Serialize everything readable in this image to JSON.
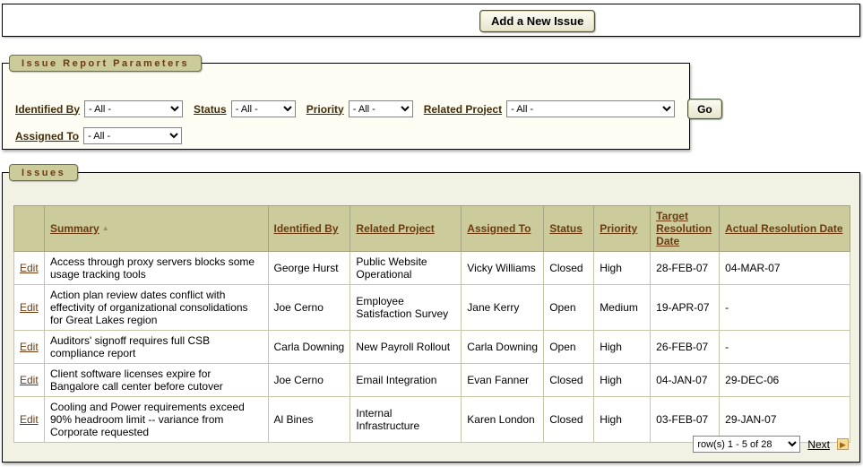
{
  "top_bar": {
    "add_button_label": "Add a New Issue"
  },
  "params": {
    "title": "Issue Report Parameters",
    "go_label": "Go",
    "fields": [
      {
        "label": "Identified By",
        "value": "- All -"
      },
      {
        "label": "Status",
        "value": "- All -"
      },
      {
        "label": "Priority",
        "value": "- All -"
      },
      {
        "label": "Related Project",
        "value": "- All -"
      },
      {
        "label": "Assigned To",
        "value": "- All -"
      }
    ]
  },
  "issues": {
    "title": "Issues",
    "edit_label": "Edit",
    "columns": [
      "Summary",
      "Identified By",
      "Related Project",
      "Assigned To",
      "Status",
      "Priority",
      "Target Resolution Date",
      "Actual Resolution Date"
    ],
    "sort": {
      "column": "Summary",
      "direction": "ascending"
    },
    "rows": [
      {
        "summary": "Access through proxy servers blocks some usage tracking tools",
        "identified_by": "George Hurst",
        "related_project": "Public Website Operational",
        "assigned_to": "Vicky Williams",
        "status": "Closed",
        "priority": "High",
        "target_resolution_date": "28-FEB-07",
        "actual_resolution_date": "04-MAR-07"
      },
      {
        "summary": "Action plan review dates conflict with effectivity of organizational consolidations for Great Lakes region",
        "identified_by": "Joe Cerno",
        "related_project": "Employee Satisfaction Survey",
        "assigned_to": "Jane Kerry",
        "status": "Open",
        "priority": "Medium",
        "target_resolution_date": "19-APR-07",
        "actual_resolution_date": "-"
      },
      {
        "summary": "Auditors' signoff requires full CSB compliance report",
        "identified_by": "Carla Downing",
        "related_project": "New Payroll Rollout",
        "assigned_to": "Carla Downing",
        "status": "Open",
        "priority": "High",
        "target_resolution_date": "26-FEB-07",
        "actual_resolution_date": "-"
      },
      {
        "summary": "Client software licenses expire for Bangalore call center before cutover",
        "identified_by": "Joe Cerno",
        "related_project": "Email Integration",
        "assigned_to": "Evan Fanner",
        "status": "Closed",
        "priority": "High",
        "target_resolution_date": "04-JAN-07",
        "actual_resolution_date": "29-DEC-06"
      },
      {
        "summary": "Cooling and Power requirements exceed 90% headroom limit -- variance from Corporate requested",
        "identified_by": "Al Bines",
        "related_project": "Internal Infrastructure",
        "assigned_to": "Karen London",
        "status": "Closed",
        "priority": "High",
        "target_resolution_date": "03-FEB-07",
        "actual_resolution_date": "29-JAN-07"
      }
    ],
    "pagination": {
      "range_value": "row(s) 1 - 5 of 28",
      "next_label": "Next"
    }
  },
  "colors": {
    "region_tab_bg": "#CBCB9C",
    "table_header_bg": "#CBCB9C",
    "heading_text": "#6E3A10",
    "region_bg": "#F2F2E4",
    "next_icon": "#C89B4B"
  }
}
